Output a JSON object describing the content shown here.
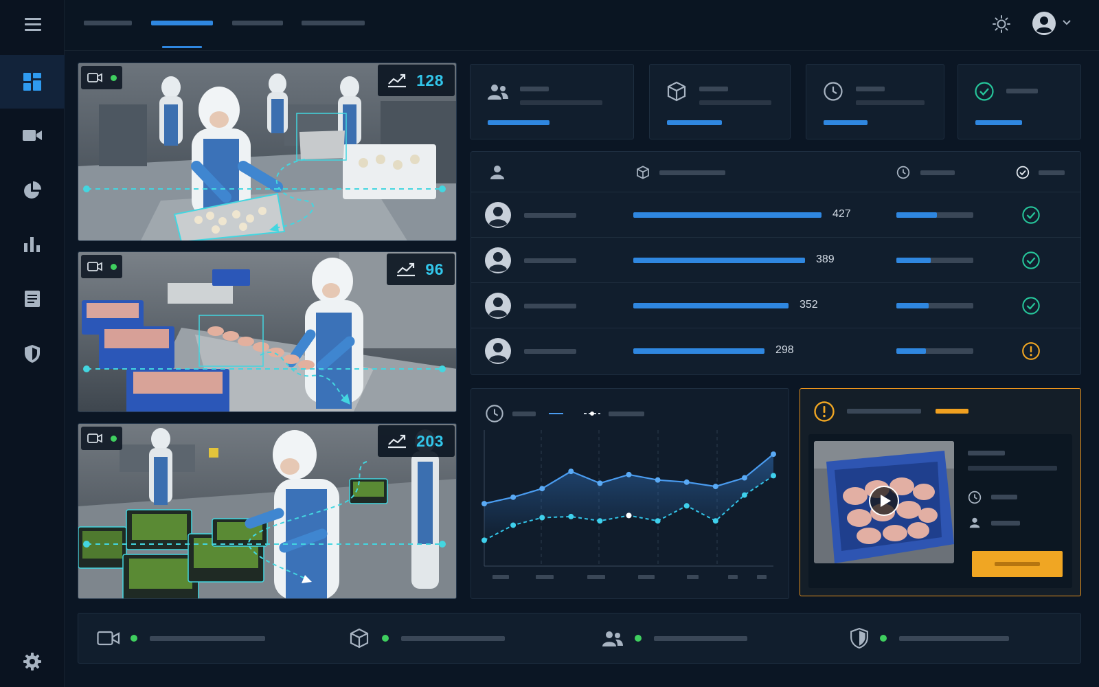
{
  "theme": {
    "background": "#0b1624",
    "accent": "#2f87e0",
    "cyan": "#32c6ea",
    "ok": "#26c59a",
    "warning": "#f0a623",
    "live": "#3fcf5f"
  },
  "sidebar": {
    "menu_icon": "menu-icon",
    "items": [
      {
        "icon": "dashboard-icon",
        "active": true
      },
      {
        "icon": "camera-icon",
        "active": false
      },
      {
        "icon": "pie-chart-icon",
        "active": false
      },
      {
        "icon": "bar-chart-icon",
        "active": false
      },
      {
        "icon": "document-icon",
        "active": false
      },
      {
        "icon": "shield-icon",
        "active": false
      }
    ],
    "footer_icon": "gear-icon"
  },
  "header": {
    "tabs": [
      {
        "active": false
      },
      {
        "active": true
      },
      {
        "active": false
      },
      {
        "active": false
      }
    ],
    "icons": [
      "sun-icon",
      "user-avatar-icon",
      "chevron-down-icon"
    ]
  },
  "cameras": [
    {
      "status": "live",
      "count": "128",
      "icon": "trend-icon"
    },
    {
      "status": "live",
      "count": "96",
      "icon": "trend-icon"
    },
    {
      "status": "live",
      "count": "203",
      "icon": "trend-icon"
    }
  ],
  "kpi_cards": [
    {
      "icon": "users-icon",
      "progress": 0.44
    },
    {
      "icon": "box-icon",
      "progress": 0.4
    },
    {
      "icon": "clock-icon",
      "progress": 0.33
    },
    {
      "icon": "check-circle-icon",
      "progress": 0.41
    }
  ],
  "table": {
    "header_icons": [
      "user-icon",
      "box-icon",
      "clock-icon",
      "check-circle-icon"
    ],
    "rows": [
      {
        "value": "427",
        "share": 1.0,
        "time_fill": 0.53,
        "status": "ok"
      },
      {
        "value": "389",
        "share": 0.911,
        "time_fill": 0.45,
        "status": "ok"
      },
      {
        "value": "352",
        "share": 0.824,
        "time_fill": 0.42,
        "status": "ok"
      },
      {
        "value": "298",
        "share": 0.698,
        "time_fill": 0.38,
        "status": "warning"
      }
    ]
  },
  "chart_data": {
    "type": "line",
    "series": [
      {
        "values": [
          58,
          64,
          72,
          88,
          77,
          85,
          80,
          78,
          74,
          82,
          104
        ]
      },
      {
        "values": [
          24,
          38,
          45,
          46,
          42,
          47,
          42,
          56,
          42,
          66,
          84
        ]
      }
    ],
    "ylim": [
      0,
      120
    ],
    "grid": true,
    "legend_position": "top-left"
  },
  "alert": {
    "icon": "alert-icon",
    "action": "play-icon"
  },
  "status_bar": [
    {
      "icon": "camera-icon",
      "status": "online"
    },
    {
      "icon": "box-icon",
      "status": "online"
    },
    {
      "icon": "users-icon",
      "status": "online"
    },
    {
      "icon": "shield-icon",
      "status": "online"
    }
  ]
}
